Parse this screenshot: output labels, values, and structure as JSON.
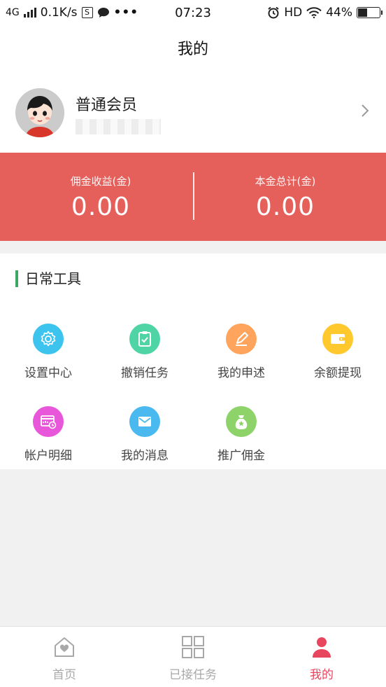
{
  "status_bar": {
    "network": "4G",
    "speed": "0.1K/s",
    "time": "07:23",
    "hd": "HD",
    "battery": "44%",
    "battery_level": 0.44
  },
  "header": {
    "title": "我的"
  },
  "profile": {
    "member_level": "普通会员"
  },
  "earnings": {
    "commission_label": "佣金收益(金)",
    "commission_value": "0.00",
    "principal_label": "本金总计(金)",
    "principal_value": "0.00"
  },
  "tools": {
    "title": "日常工具",
    "items": [
      {
        "label": "设置中心",
        "icon": "gear-icon",
        "color": "#3cc3ee"
      },
      {
        "label": "撤销任务",
        "icon": "clipboard-check-icon",
        "color": "#4fd4a6"
      },
      {
        "label": "我的申述",
        "icon": "edit-icon",
        "color": "#ffa45c"
      },
      {
        "label": "余额提现",
        "icon": "wallet-icon",
        "color": "#ffc82c"
      },
      {
        "label": "帐户明细",
        "icon": "account-detail-icon",
        "color": "#e857d9"
      },
      {
        "label": "我的消息",
        "icon": "mail-icon",
        "color": "#4ab9f0"
      },
      {
        "label": "推广佣金",
        "icon": "money-bag-icon",
        "color": "#8ed26a"
      }
    ]
  },
  "bottom_nav": {
    "items": [
      {
        "label": "首页",
        "icon": "home-icon"
      },
      {
        "label": "已接任务",
        "icon": "grid-icon"
      },
      {
        "label": "我的",
        "icon": "user-icon"
      }
    ],
    "active_color": "#e8465f"
  },
  "colors": {
    "banner": "#e5605b",
    "accent": "#3ca663"
  }
}
